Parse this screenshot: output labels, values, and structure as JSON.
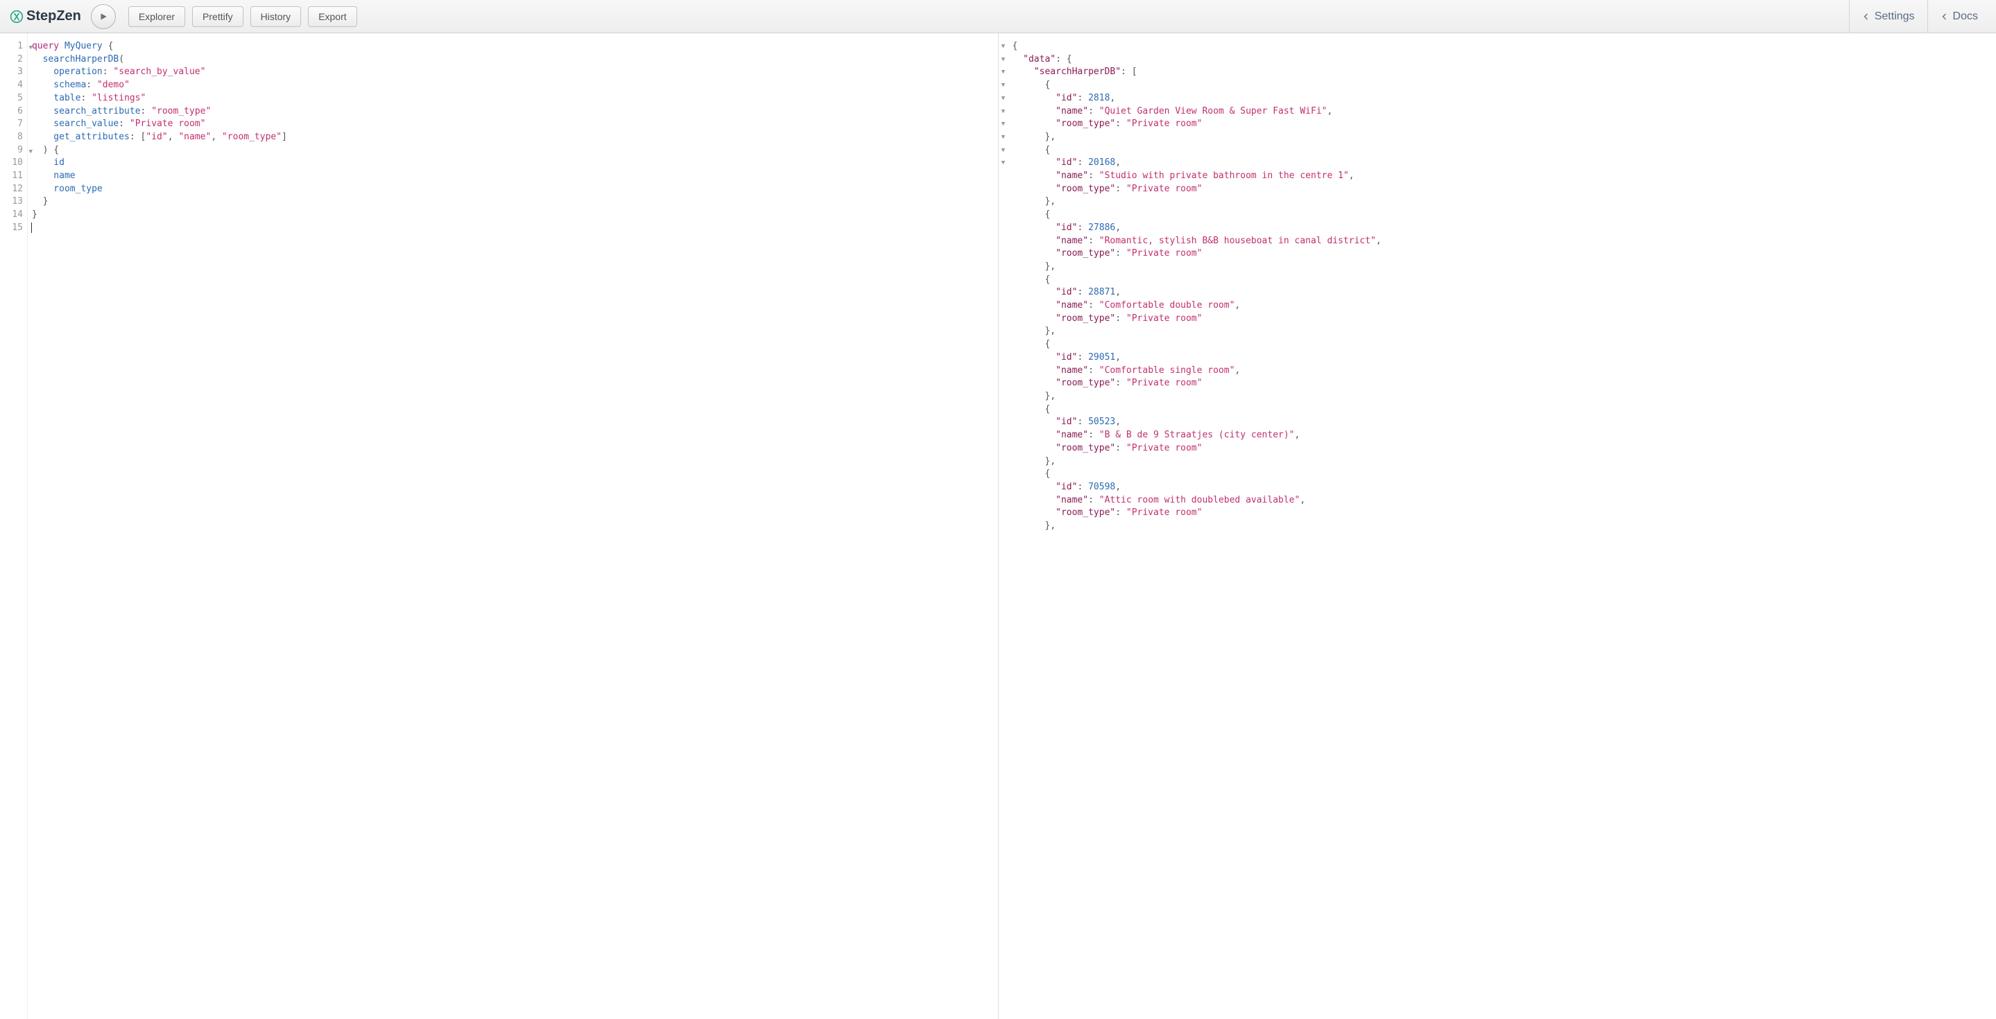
{
  "logo_text": "StepZen",
  "toolbar": {
    "explorer": "Explorer",
    "prettify": "Prettify",
    "history": "History",
    "export": "Export",
    "settings": "Settings",
    "docs": "Docs"
  },
  "query_lines": {
    "l1": "query MyQuery {",
    "l2": "  searchHarperDB(",
    "l3_attr": "    operation",
    "l3_val": "\"search_by_value\"",
    "l4_attr": "    schema",
    "l4_val": "\"demo\"",
    "l5_attr": "    table",
    "l5_val": "\"listings\"",
    "l6_attr": "    search_attribute",
    "l6_val": "\"room_type\"",
    "l7_attr": "    search_value",
    "l7_val": "\"Private room\"",
    "l8_attr": "    get_attributes",
    "l8_v1": "\"id\"",
    "l8_v2": "\"name\"",
    "l8_v3": "\"room_type\"",
    "l9": "  ) {",
    "l10": "    id",
    "l11": "    name",
    "l12": "    room_type",
    "l13": "  }",
    "l14": "}"
  },
  "line_numbers": [
    "1",
    "2",
    "3",
    "4",
    "5",
    "6",
    "7",
    "8",
    "9",
    "10",
    "11",
    "12",
    "13",
    "14",
    "15"
  ],
  "result": {
    "data_key": "\"data\"",
    "search_key": "\"searchHarperDB\"",
    "id_key": "\"id\"",
    "name_key": "\"name\"",
    "room_type_key": "\"room_type\"",
    "records": [
      {
        "id": "2818",
        "name": "\"Quiet Garden View Room & Super Fast WiFi\"",
        "room_type": "\"Private room\""
      },
      {
        "id": "20168",
        "name": "\"Studio with private bathroom in the centre 1\"",
        "room_type": "\"Private room\""
      },
      {
        "id": "27886",
        "name": "\"Romantic, stylish B&B houseboat in canal district\"",
        "room_type": "\"Private room\""
      },
      {
        "id": "28871",
        "name": "\"Comfortable double room\"",
        "room_type": "\"Private room\""
      },
      {
        "id": "29051",
        "name": "\"Comfortable single room\"",
        "room_type": "\"Private room\""
      },
      {
        "id": "50523",
        "name": "\"B & B de 9 Straatjes (city center)\"",
        "room_type": "\"Private room\""
      },
      {
        "id": "70598",
        "name": "\"Attic room with doublebed available\"",
        "room_type": "\"Private room\""
      }
    ]
  }
}
